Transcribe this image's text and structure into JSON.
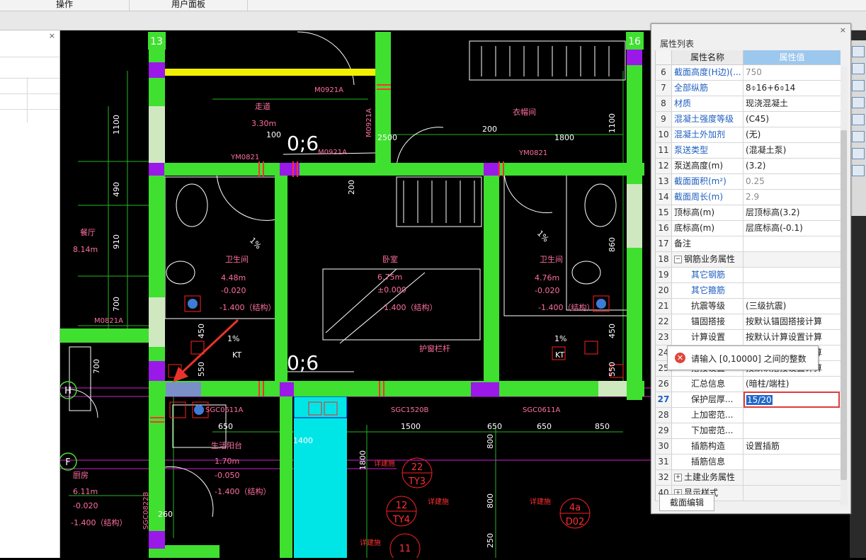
{
  "menubar": {
    "tabs": [
      "操作",
      "用户面板"
    ]
  },
  "cad": {
    "axis_bubbles": [
      "13",
      "16"
    ],
    "side_axis_labels": [
      "H",
      "F"
    ],
    "room_labels": [
      {
        "text": "走道"
      },
      {
        "text": "3.30m"
      },
      {
        "text": "衣帽间"
      },
      {
        "text": "餐厅"
      },
      {
        "text": "8.14m"
      },
      {
        "text": "卫生间"
      },
      {
        "text": "4.48m"
      },
      {
        "text": "-0.020"
      },
      {
        "text": "-1.400（结构）"
      },
      {
        "text": "卧室"
      },
      {
        "text": "6.75m"
      },
      {
        "text": "±0.000"
      },
      {
        "text": "-1.400（结构）"
      },
      {
        "text": "卫生间"
      },
      {
        "text": "4.76m"
      },
      {
        "text": "-0.020"
      },
      {
        "text": "-1.400（结构）"
      },
      {
        "text": "生活阳台"
      },
      {
        "text": "1.70m"
      },
      {
        "text": "-0.050"
      },
      {
        "text": "-1.400（结构）"
      },
      {
        "text": "厨房"
      },
      {
        "text": "6.11m"
      },
      {
        "text": "-0.020"
      },
      {
        "text": "-1.400（结构）"
      },
      {
        "text": "护窗栏杆"
      }
    ],
    "door_labels": [
      "M0921A",
      "M0921A",
      "YM0821",
      "M0921A",
      "YM0821",
      "M0821A",
      "SGC0611A",
      "SGC1520B",
      "SGC0611A",
      "SGC0822B"
    ],
    "dimensions": [
      "1100",
      "490",
      "910",
      "700",
      "700",
      "1100",
      "860",
      "100",
      "2500",
      "200",
      "1800",
      "200",
      "650",
      "1500",
      "650",
      "650",
      "850",
      "450",
      "550",
      "450",
      "550",
      "800",
      "800",
      "250",
      "1800",
      "1400",
      "260"
    ],
    "slopes": [
      "1%",
      "1%",
      "1%",
      "1%"
    ],
    "kt_labels": [
      "KT",
      "KT"
    ],
    "big_labels": [
      "0;6",
      "0;6"
    ],
    "callouts": [
      {
        "top": "22",
        "bottom": "TY3"
      },
      {
        "top": "12",
        "bottom": "TY4"
      },
      {
        "top": "4a",
        "bottom": "D02"
      },
      {
        "top": "11",
        "bottom": ""
      }
    ],
    "detail_labels": [
      "详建施",
      "详建施",
      "详建施",
      "详建施"
    ],
    "colors": {
      "wall_green": "#3fe02f",
      "wall_purple": "#a020f0",
      "dim_green": "#22b622",
      "label_pink": "#ff6fa0",
      "cyan": "#00ffff",
      "red": "#ff0000",
      "arrow_red": "#e8332b"
    }
  },
  "panel": {
    "title": "属性列表",
    "col_name": "属性名称",
    "col_value": "属性值",
    "rows": [
      {
        "num": "6",
        "name": "截面高度(H边)(...",
        "value": "750",
        "blue": true,
        "gray": true
      },
      {
        "num": "7",
        "name": "全部纵筋",
        "value": "8⌽16+6⌽14",
        "blue": true,
        "gray": false
      },
      {
        "num": "8",
        "name": "材质",
        "value": "现浇混凝土",
        "blue": true,
        "gray": false
      },
      {
        "num": "9",
        "name": "混凝土强度等级",
        "value": "(C45)",
        "blue": true,
        "gray": false
      },
      {
        "num": "10",
        "name": "混凝土外加剂",
        "value": "(无)",
        "blue": true,
        "gray": false
      },
      {
        "num": "11",
        "name": "泵送类型",
        "value": "(混凝土泵)",
        "blue": true,
        "gray": false
      },
      {
        "num": "12",
        "name": "泵送高度(m)",
        "value": "(3.2)",
        "blue": false,
        "gray": false
      },
      {
        "num": "13",
        "name": "截面面积(m²)",
        "value": "0.25",
        "blue": true,
        "gray": true
      },
      {
        "num": "14",
        "name": "截面周长(m)",
        "value": "2.9",
        "blue": true,
        "gray": true
      },
      {
        "num": "15",
        "name": "顶标高(m)",
        "value": "层顶标高(3.2)",
        "blue": false,
        "gray": false
      },
      {
        "num": "16",
        "name": "底标高(m)",
        "value": "层底标高(-0.1)",
        "blue": false,
        "gray": false
      },
      {
        "num": "17",
        "name": "备注",
        "value": "",
        "blue": false,
        "gray": false
      },
      {
        "num": "18",
        "name": "钢筋业务属性",
        "value": "",
        "group": true,
        "expander": "−"
      },
      {
        "num": "19",
        "name": "其它钢筋",
        "value": "",
        "blue": true,
        "indent": true
      },
      {
        "num": "20",
        "name": "其它箍筋",
        "value": "",
        "blue": true,
        "indent": true
      },
      {
        "num": "21",
        "name": "抗震等级",
        "value": "(三级抗震)",
        "indent": true
      },
      {
        "num": "22",
        "name": "锚固搭接",
        "value": "按默认锚固搭接计算",
        "indent": true
      },
      {
        "num": "23",
        "name": "计算设置",
        "value": "按默认计算设置计算",
        "indent": true
      },
      {
        "num": "24",
        "name": "节点设置",
        "value": "按默认节点设置计算",
        "indent": true
      },
      {
        "num": "25",
        "name": "搭接设置",
        "value": "按默认搭接设置计算",
        "indent": true
      },
      {
        "num": "26",
        "name": "汇总信息",
        "value": "(暗柱/端柱)",
        "indent": true
      },
      {
        "num": "27",
        "name": "保护层厚...",
        "value": "15/20",
        "indent": true,
        "editing": true
      },
      {
        "num": "28",
        "name": "上加密范...",
        "value": "",
        "indent": true
      },
      {
        "num": "29",
        "name": "下加密范...",
        "value": "",
        "indent": true
      },
      {
        "num": "30",
        "name": "插筋构造",
        "value": "设置插筋",
        "indent": true
      },
      {
        "num": "31",
        "name": "插筋信息",
        "value": "",
        "indent": true
      },
      {
        "num": "32",
        "name": "土建业务属性",
        "value": "",
        "group": true,
        "expander": "+"
      },
      {
        "num": "40",
        "name": "显示样式",
        "value": "",
        "group": true,
        "expander": "+"
      }
    ],
    "button_label": "截面编辑"
  },
  "error_tooltip": {
    "icon": "error-icon",
    "message": "请输入 [0,10000] 之间的整数"
  }
}
